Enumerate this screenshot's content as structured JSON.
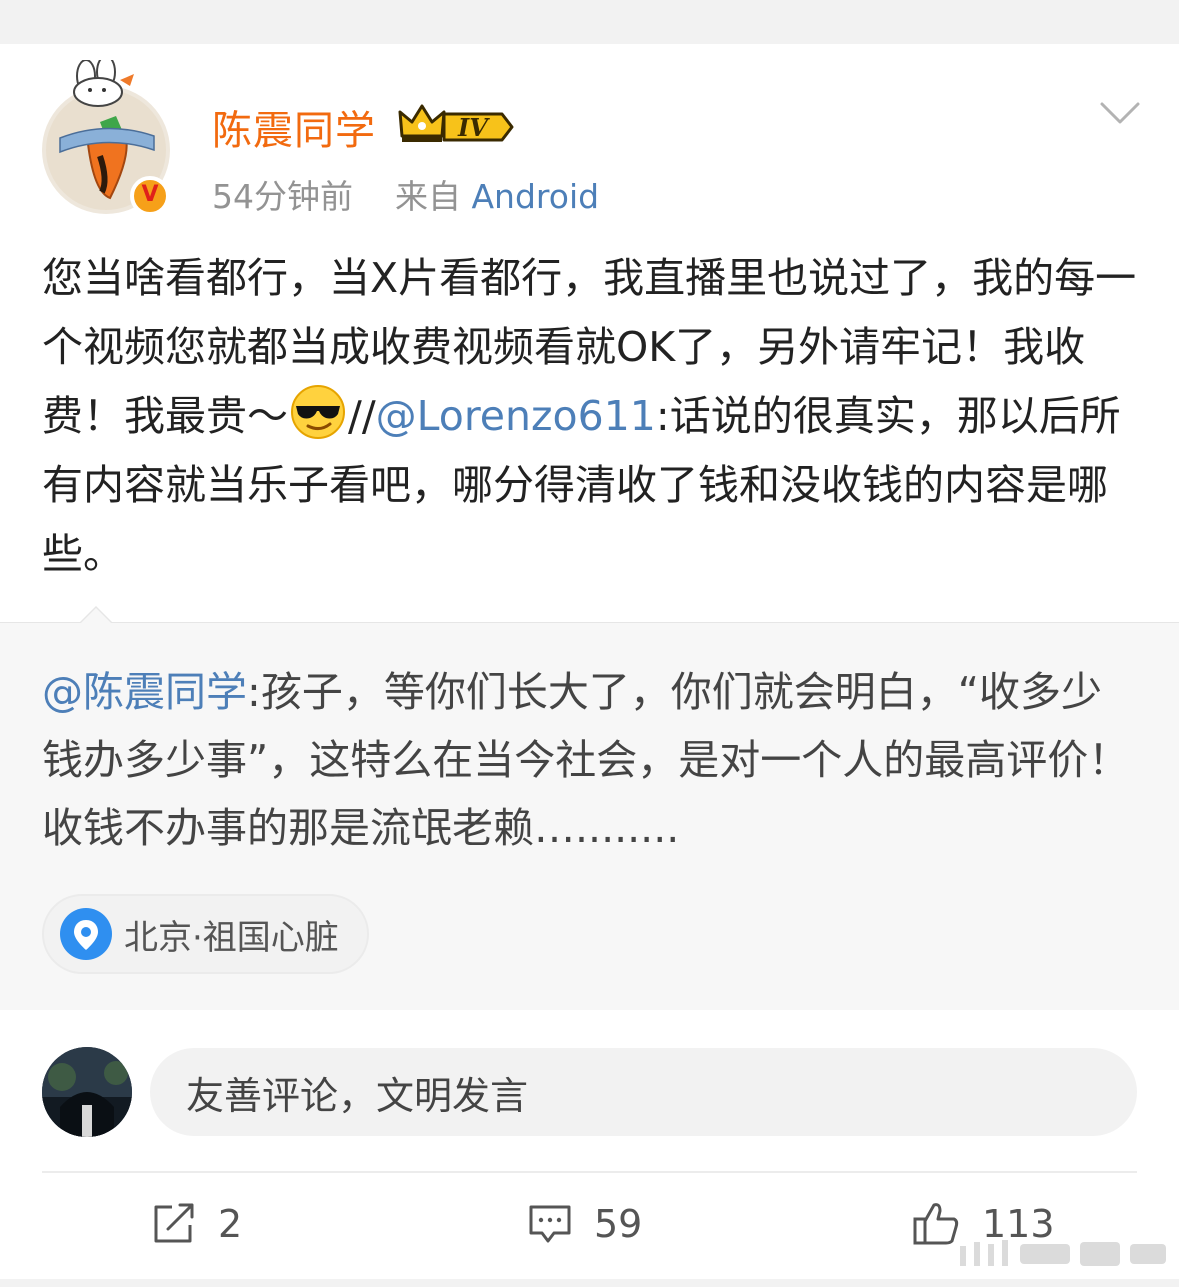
{
  "post": {
    "author": "陈震同学",
    "vip_level": "IV",
    "verified_mark": "V",
    "time": "54分钟前",
    "source_prefix": "来自",
    "source": "Android",
    "text_1": "您当啥看都行，当X片看都行，我直播里也说过了，我的每一个视频您就都当成收费视频看就OK了，另外请牢记！我收费！我最贵～",
    "repost_sep": "//",
    "repost_mention": "@Lorenzo611",
    "text_2": ":话说的很真实，那以后所有内容就当乐子看吧，哪分得清收了钱和没收钱的内容是哪些。"
  },
  "quoted": {
    "mention": "@陈震同学",
    "text": ":孩子，等你们长大了，你们就会明白，“收多少钱办多少事”，这特么在当今社会，是对一个人的最高评价！收钱不办事的那是流氓老赖…........"
  },
  "location": {
    "label": "北京·祖国心脏"
  },
  "comment": {
    "placeholder": "友善评论，文明发言"
  },
  "actions": {
    "share_count": "2",
    "comment_count": "59",
    "like_count": "113"
  },
  "colors": {
    "username": "#f26a0f",
    "link": "#4d7fb8",
    "location_pin": "#2f8ff0"
  },
  "icons": [
    "chevron-down-icon",
    "crown-icon",
    "sunglasses-emoji",
    "location-pin-icon",
    "share-icon",
    "comment-icon",
    "like-icon"
  ]
}
